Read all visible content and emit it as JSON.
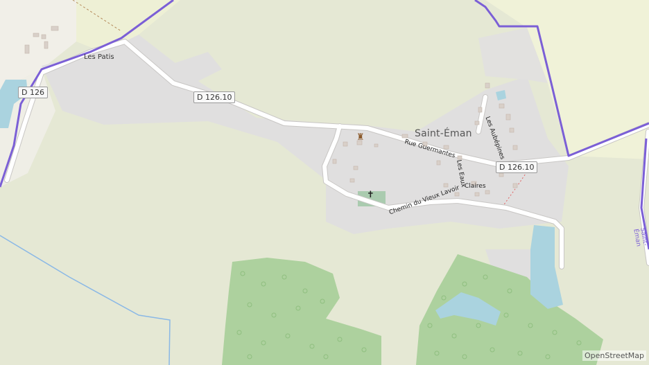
{
  "map": {
    "place_label": "Saint-Éman",
    "hamlet_label": "Les Patis",
    "road_shields": {
      "d126_west": "D 126",
      "d126_10_west": "D 126.10",
      "d126_10_east": "D 126.10"
    },
    "street_labels": {
      "rue_guermantes": "Rue Guermantes",
      "chemin_vieux_lavoir": "Chemin du Vieux Lavoir",
      "les_aubepines": "Les Aubépines",
      "les_eaux": "Les Eaux",
      "claires": "Claires"
    },
    "boundary_label": "Saint-Éman",
    "attribution": "OpenStreetMap",
    "colors": {
      "background": "#f2efe9",
      "farmland": "#eef0d5",
      "meadow": "#e4e6d0",
      "residential": "#e0dfdf",
      "forest": "#add19e",
      "water": "#aad3df",
      "boundary": "#7b5fd6",
      "road": "#ffffff",
      "stream": "#8ab8e6",
      "cemetery": "#aacbaf"
    },
    "icons": {
      "church": "cross-icon",
      "town_hall": "town-hall-icon"
    }
  }
}
